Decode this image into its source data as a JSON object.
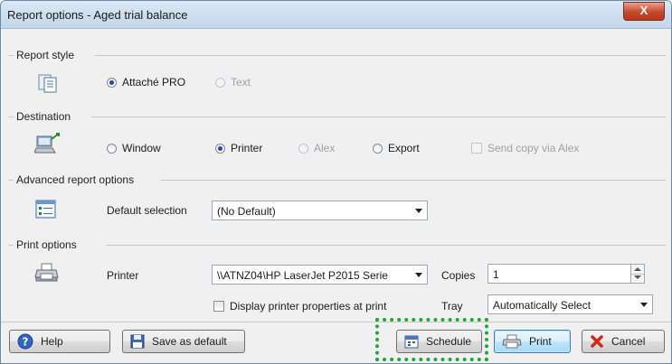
{
  "window": {
    "title": "Report options - Aged trial balance",
    "close_label": "X"
  },
  "report_style": {
    "section_label": "Report style",
    "attache_pro": "Attaché PRO",
    "text": "Text"
  },
  "destination": {
    "section_label": "Destination",
    "window": "Window",
    "printer": "Printer",
    "alex": "Alex",
    "export": "Export",
    "send_copy": "Send copy via Alex"
  },
  "advanced": {
    "section_label": "Advanced report options",
    "default_selection_label": "Default selection",
    "default_selection_value": "(No Default)"
  },
  "print_options": {
    "section_label": "Print options",
    "printer_label": "Printer",
    "printer_value": "\\\\ATNZ04\\HP LaserJet P2015 Serie",
    "copies_label": "Copies",
    "copies_value": "1",
    "display_props": "Display printer properties at print",
    "tray_label": "Tray",
    "tray_value": "Automatically Select"
  },
  "footer": {
    "help": "Help",
    "save_default": "Save as default",
    "schedule": "Schedule",
    "print": "Print",
    "cancel": "Cancel"
  },
  "colors": {
    "highlight": "#21a63a",
    "title_bar": "#c3d6ea",
    "close": "#c7472b"
  }
}
